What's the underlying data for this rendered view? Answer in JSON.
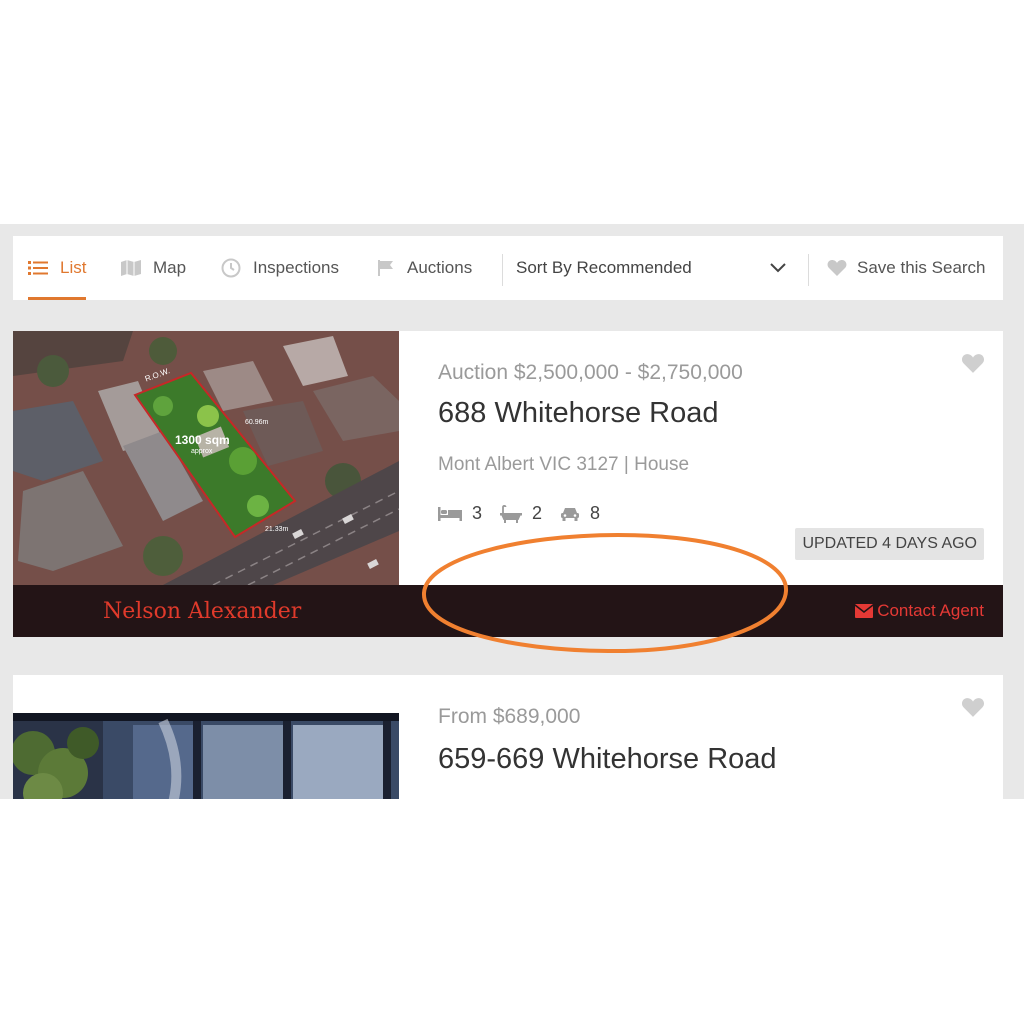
{
  "toolbar": {
    "tabs": [
      {
        "label": "List",
        "icon": "list-icon",
        "active": true
      },
      {
        "label": "Map",
        "icon": "map-icon",
        "active": false
      },
      {
        "label": "Inspections",
        "icon": "clock-icon",
        "active": false
      },
      {
        "label": "Auctions",
        "icon": "flag-icon",
        "active": false
      }
    ],
    "sort_label": "Sort By Recommended",
    "save_search_label": "Save this Search"
  },
  "colors": {
    "accent": "#e0782f",
    "agent_bar": "#231416",
    "agency_red": "#e03a2b",
    "page_bg": "#e8e8e8"
  },
  "listings": [
    {
      "price": "Auction $2,500,000 - $2,750,000",
      "address": "688 Whitehorse Road",
      "suburb": "Mont Albert VIC 3127 | House",
      "beds": "3",
      "baths": "2",
      "cars": "8",
      "updated": "UPDATED 4 DAYS AGO",
      "agency": "Nelson Alexander",
      "contact_label": "Contact Agent",
      "photo_labels": {
        "area": "1300 sqm",
        "area_note": "approx",
        "row": "R.O.W.",
        "side_dim": "60.96m",
        "front_dim": "21.33m"
      }
    },
    {
      "price": "From $689,000",
      "address": "659-669 Whitehorse Road"
    }
  ]
}
